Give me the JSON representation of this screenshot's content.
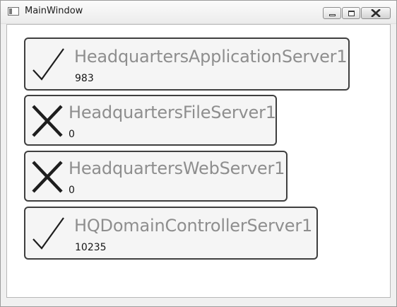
{
  "window": {
    "title": "MainWindow",
    "icon": "application-window-icon"
  },
  "controls": {
    "minimize": "minimize-icon",
    "maximize": "maximize-icon",
    "close": "close-icon"
  },
  "servers": [
    {
      "name": "HeadquartersApplicationServer1",
      "value": "983",
      "status": "ok",
      "icon": "checkmark-icon"
    },
    {
      "name": "HeadquartersFileServer1",
      "value": "0",
      "status": "down",
      "icon": "cross-icon"
    },
    {
      "name": "HeadquartersWebServer1",
      "value": "0",
      "status": "down",
      "icon": "cross-icon"
    },
    {
      "name": "HQDomainControllerServer1",
      "value": "10235",
      "status": "ok",
      "icon": "checkmark-icon"
    }
  ]
}
